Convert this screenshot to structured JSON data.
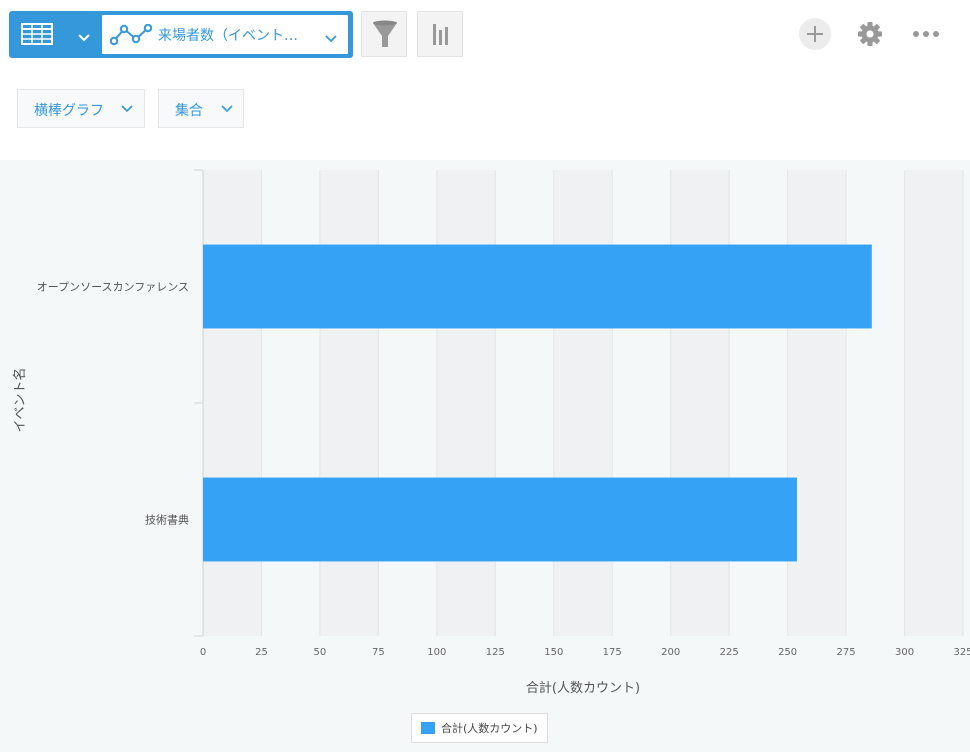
{
  "toolbar": {
    "graph_name": "来場者数（イベント…",
    "icons": [
      "table-icon",
      "chevron-down-icon",
      "line-chart-icon",
      "filter-icon",
      "bar-chart-icon",
      "plus-icon",
      "gear-icon",
      "more-icon"
    ]
  },
  "options": {
    "chart_type": "横棒グラフ",
    "aggregation": "集合"
  },
  "colors": {
    "accent": "#3498db",
    "bar": "#36a2f5"
  },
  "chart_data": {
    "type": "bar",
    "orientation": "horizontal",
    "categories": [
      "オープンソースカンファレンス",
      "技術書典"
    ],
    "series": [
      {
        "name": "合計(人数カウント)",
        "values": [
          286,
          254
        ]
      }
    ],
    "xlabel": "合計(人数カウント)",
    "ylabel": "イベント名",
    "xlim": [
      0,
      325
    ],
    "xticks": [
      0,
      25,
      50,
      75,
      100,
      125,
      150,
      175,
      200,
      225,
      250,
      275,
      300,
      325
    ],
    "grid": "alternating-bands",
    "legend": "bottom-center"
  }
}
